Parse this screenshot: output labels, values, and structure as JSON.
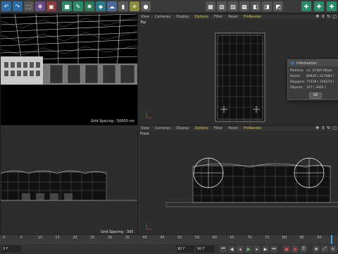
{
  "viewports": {
    "top_left": {
      "grid_spacing": "Grid Spacing : 50000 cm"
    },
    "top_right": {
      "menu": [
        "View",
        "Cameras",
        "Display",
        "Options",
        "Filter",
        "Panel",
        "ProRender"
      ],
      "label": "Top"
    },
    "bottom_left": {
      "grid_spacing": "Grid Spacing : 300 cm"
    },
    "bottom_right": {
      "menu": [
        "View",
        "Cameras",
        "Display",
        "Options",
        "Filter",
        "Panel",
        "ProRender"
      ],
      "label": "Front"
    }
  },
  "dialog": {
    "title": "Information",
    "rows": [
      {
        "label": "Memory:",
        "value": "ca. 22160 KByte"
      },
      {
        "label": "Points:",
        "value": "89420 ( 327684 )"
      },
      {
        "label": "Polygons:",
        "value": "71538 ( 326274 )"
      },
      {
        "label": "Objects:",
        "value": "327 ( 3024 )"
      }
    ],
    "ok_label": "OK"
  },
  "timeline": {
    "ticks": [
      "0",
      "5",
      "10",
      "15",
      "20",
      "25",
      "30",
      "35",
      "40",
      "45",
      "50",
      "55",
      "60",
      "65",
      "70",
      "75",
      "80",
      "85",
      "90"
    ],
    "start_field": "0 F",
    "end_field": "90 F",
    "frame_field": "90 F"
  },
  "colors": {
    "accent": "#e6c84a",
    "viewport_bg": "#000000",
    "gray_bg": "#2d2d2d"
  }
}
